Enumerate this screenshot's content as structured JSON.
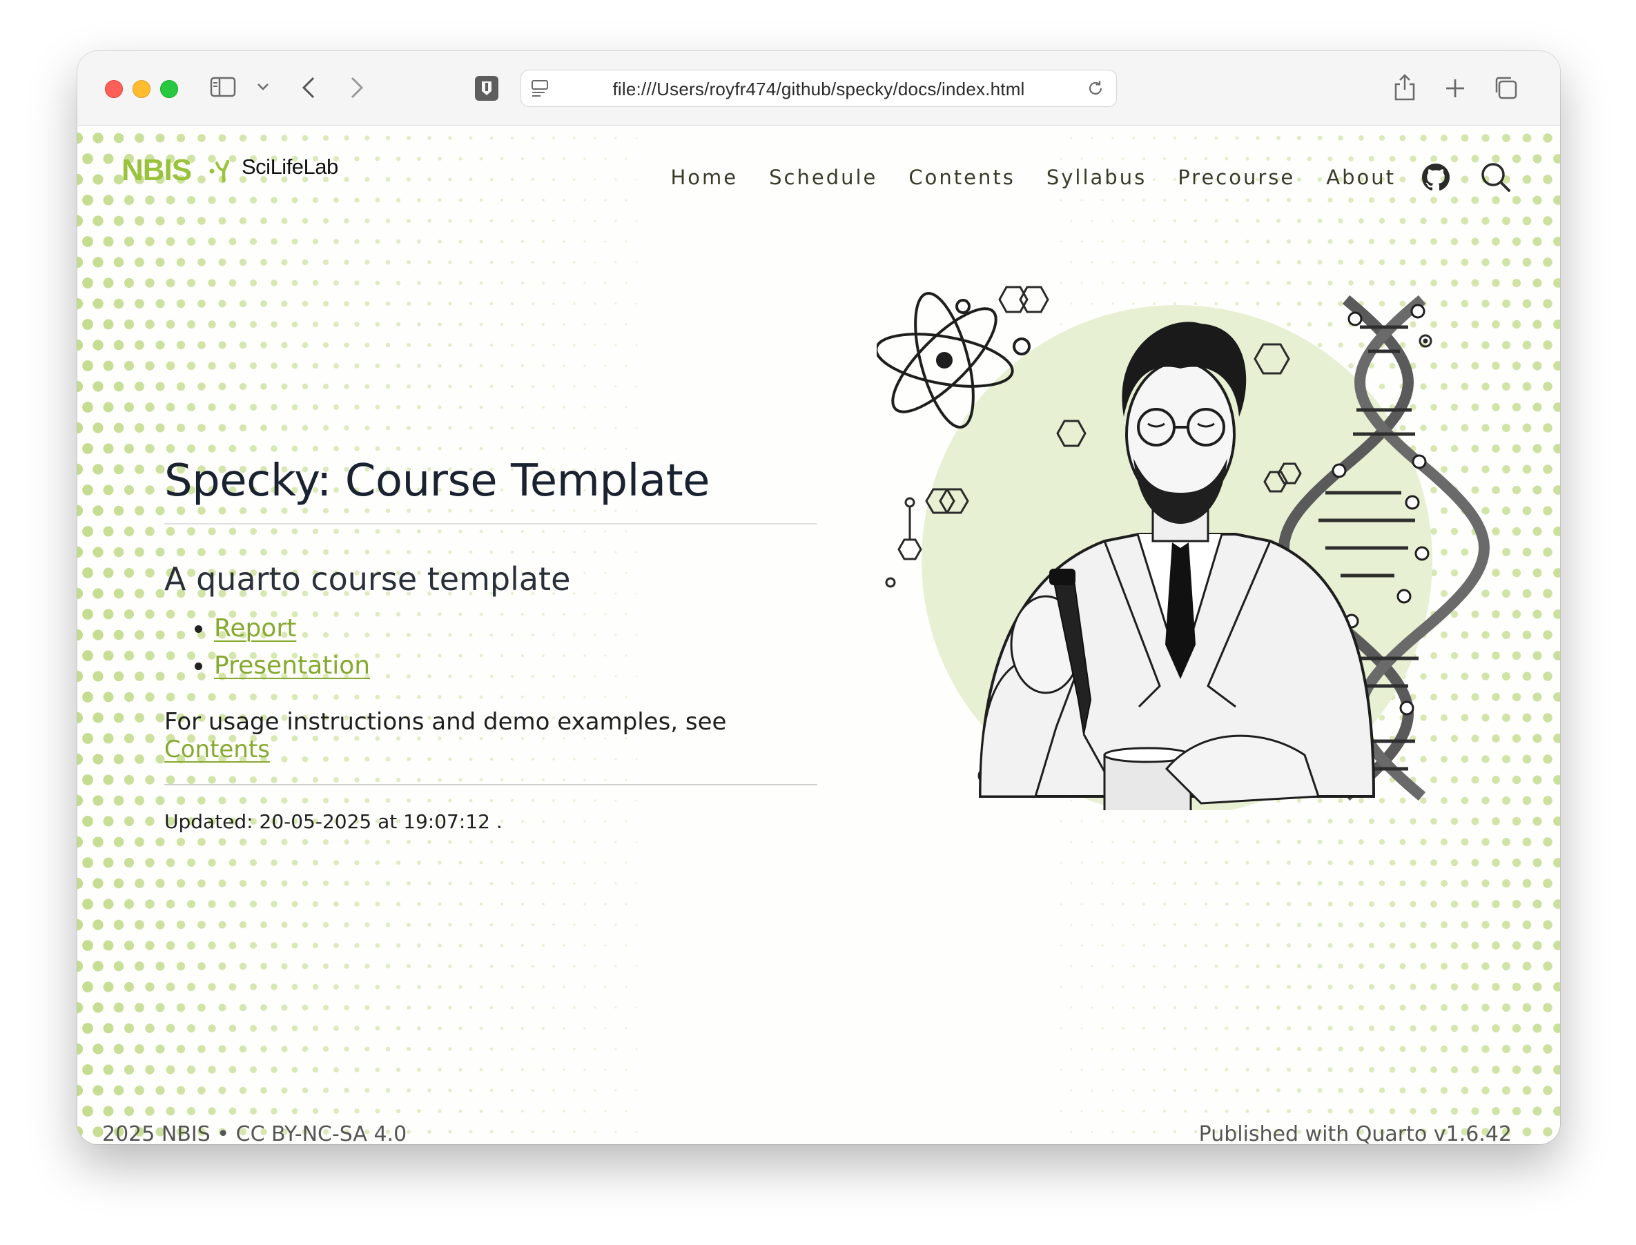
{
  "browser": {
    "address": "file:///Users/royfr474/github/specky/docs/index.html"
  },
  "brand": {
    "logo_primary": "NBIS",
    "logo_secondary": "SciLifeLab"
  },
  "nav": {
    "items": [
      "Home",
      "Schedule",
      "Contents",
      "Syllabus",
      "Precourse",
      "About"
    ],
    "github_icon": "github-icon",
    "search_icon": "search-icon"
  },
  "main": {
    "title": "Specky: Course Template",
    "subtitle": "A quarto course template",
    "links": [
      "Report",
      "Presentation"
    ],
    "usage_prefix": "For usage instructions and demo examples, see ",
    "usage_link": "Contents",
    "updated": "Updated: 20-05-2025 at 19:07:12 ."
  },
  "footer": {
    "year": "2025",
    "org": "NBIS",
    "bullet": "•",
    "license": "CC BY-NC-SA 4.0",
    "published_prefix": "Published with",
    "quarto": "Quarto",
    "version": "v1.6.42"
  },
  "colors": {
    "accent_green": "#9bc23c",
    "link_green": "#86a92f",
    "title_dark": "#1a2230"
  }
}
